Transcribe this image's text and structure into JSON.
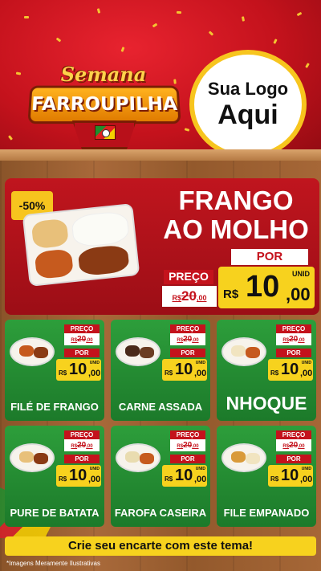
{
  "header": {
    "badge_top": "Semana",
    "badge_main": "FARROUPILHA",
    "logo_line1": "Sua Logo",
    "logo_line2": "Aqui"
  },
  "hero": {
    "discount": "-50%",
    "title_line1": "FRANGO",
    "title_line2": "AO MOLHO",
    "por_label": "POR",
    "preco_label": "PREÇO",
    "old_currency": "R$",
    "old_int": "20",
    "old_dec": ",00",
    "currency": "R$",
    "price_int": "10",
    "price_dec": ",00",
    "unid": "UNID"
  },
  "products": [
    {
      "name": "FILÉ DE FRANGO",
      "preco_label": "PREÇO",
      "old_currency": "R$",
      "old_int": "20",
      "old_dec": ",00",
      "por_label": "POR",
      "currency": "R$",
      "price_int": "10",
      "price_dec": ",00",
      "unid": "UNID"
    },
    {
      "name": "CARNE ASSADA",
      "preco_label": "PREÇO",
      "old_currency": "R$",
      "old_int": "20",
      "old_dec": ",00",
      "por_label": "POR",
      "currency": "R$",
      "price_int": "10",
      "price_dec": ",00",
      "unid": "UNID"
    },
    {
      "name": "NHOQUE",
      "preco_label": "PREÇO",
      "old_currency": "R$",
      "old_int": "20",
      "old_dec": ",00",
      "por_label": "POR",
      "currency": "R$",
      "price_int": "10",
      "price_dec": ",00",
      "unid": "UNID"
    },
    {
      "name": "PURE DE BATATA",
      "preco_label": "PREÇO",
      "old_currency": "R$",
      "old_int": "20",
      "old_dec": ",00",
      "por_label": "POR",
      "currency": "R$",
      "price_int": "10",
      "price_dec": ",00",
      "unid": "UNID"
    },
    {
      "name": "FAROFA CASEIRA",
      "preco_label": "PREÇO",
      "old_currency": "R$",
      "old_int": "20",
      "old_dec": ",00",
      "por_label": "POR",
      "currency": "R$",
      "price_int": "10",
      "price_dec": ",00",
      "unid": "UNID"
    },
    {
      "name": "FILE EMPANADO",
      "preco_label": "PREÇO",
      "old_currency": "R$",
      "old_int": "20",
      "old_dec": ",00",
      "por_label": "POR",
      "currency": "R$",
      "price_int": "10",
      "price_dec": ",00",
      "unid": "UNID"
    }
  ],
  "footer": {
    "cta": "Crie seu encarte com este tema!",
    "disclaimer": "*Imagens Meramente Ilustrativas"
  },
  "colors": {
    "red": "#c4121c",
    "green": "#2d9e3b",
    "yellow": "#f7d21e",
    "wood": "#a8693a"
  }
}
